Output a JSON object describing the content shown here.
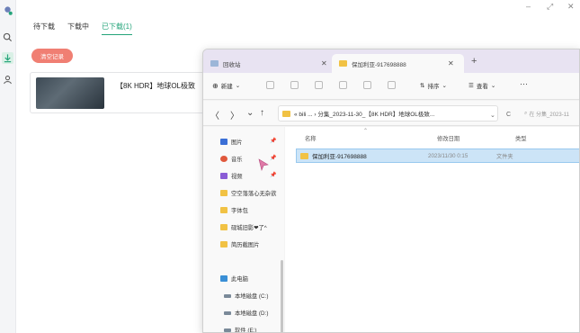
{
  "download_app": {
    "tabs": [
      {
        "label": "待下载",
        "active": false
      },
      {
        "label": "下载中",
        "active": false
      },
      {
        "label": "已下载(1)",
        "active": true
      }
    ],
    "clear_button": "清空记录",
    "downloads": [
      {
        "title": "【8K HDR】地球OL极致"
      }
    ],
    "rail_icons": [
      "app-logo-icon",
      "search-icon",
      "download-icon",
      "user-icon"
    ],
    "window_controls": [
      "–",
      "⤢",
      "✕"
    ],
    "accent_color": "#24a47a",
    "clear_color": "#f07f73"
  },
  "explorer": {
    "tabs": [
      {
        "label": "回收站",
        "active": false
      },
      {
        "label": "保加利亚-917698888",
        "active": true
      }
    ],
    "new_tab": "+",
    "toolbar": {
      "new_label": "新建",
      "sort_label": "排序",
      "view_label": "查看",
      "more_label": "···"
    },
    "address": {
      "path": "« bili ... › 分集_2023-11-30_【8K HDR】地球OL极致...",
      "dropdown": "⌄",
      "refresh": "C",
      "search_placeholder": "在 分集_2023-11"
    },
    "nav_items": [
      {
        "label": "图片",
        "pinned": true,
        "color": "#3b6fd6"
      },
      {
        "label": "音乐",
        "pinned": true,
        "color": "#e0583c"
      },
      {
        "label": "视频",
        "pinned": true,
        "color": "#8a5cd6"
      },
      {
        "label": "空空落落心无杂欲",
        "pinned": false,
        "color": "#f1c244"
      },
      {
        "label": "字体包",
        "pinned": false,
        "color": "#f1c244"
      },
      {
        "label": "砚城旧影❤了^",
        "pinned": false,
        "color": "#f1c244"
      },
      {
        "label": "简历截图片",
        "pinned": false,
        "color": "#f1c244"
      },
      {
        "label": "此电脑",
        "pinned": false,
        "color": "#3a8fd6"
      },
      {
        "label": "本地磁盘 (C:)",
        "pinned": false,
        "color": "#7a8a99"
      },
      {
        "label": "本地磁盘 (D:)",
        "pinned": false,
        "color": "#7a8a99"
      },
      {
        "label": "软件 (E:)",
        "pinned": false,
        "color": "#7a8a99"
      }
    ],
    "columns": [
      "名称",
      "修改日期",
      "类型"
    ],
    "files": [
      {
        "name": "保加利亚-917698888",
        "modified": "2023/11/30 0:15",
        "type": "文件夹"
      }
    ]
  }
}
